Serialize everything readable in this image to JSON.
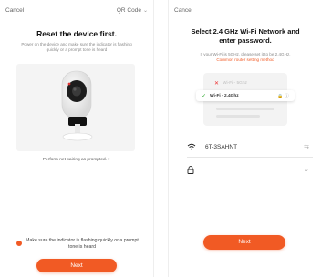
{
  "screen1": {
    "cancel": "Cancel",
    "mode": "QR Code",
    "title": "Reset the device first.",
    "instruction": "Power on the device and make sure the indicator is flashing quickly or a prompt tone is heard",
    "help_link": "Perform net pairing as prompted. >",
    "confirm": "Make sure the indicator is flashing quickly or a prompt tone is heard",
    "next": "Next",
    "colors": {
      "accent": "#f15a24"
    }
  },
  "screen2": {
    "cancel": "Cancel",
    "title_line1": "Select 2.4 GHz Wi-Fi Network and",
    "title_line2": "enter password.",
    "subtitle": "If your Wi-Fi is 5GHz, please set it to be 2.4GHz.",
    "router_link": "Common router setting method",
    "wifi_5g": "Wi-Fi - 5Ghz",
    "wifi_24": "Wi-Fi - 2.4Ghz",
    "ssid": "6T-3SAHNT",
    "next": "Next"
  }
}
